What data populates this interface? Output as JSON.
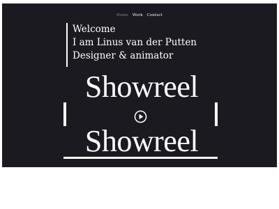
{
  "nav": {
    "items": [
      {
        "label": "Home",
        "active": true
      },
      {
        "label": "Work",
        "active": false
      },
      {
        "label": "Contact",
        "active": false
      }
    ]
  },
  "intro": {
    "line1": "Welcome",
    "line2": "I am Linus van der Putten",
    "line3": "Designer & animator"
  },
  "showreel": {
    "title_top": "Showreel",
    "title_bottom": "Showreel",
    "play_icon": "play-icon"
  },
  "colors": {
    "background": "#1b1a21",
    "text": "#ffffff",
    "nav_active": "#8a8a8f"
  }
}
